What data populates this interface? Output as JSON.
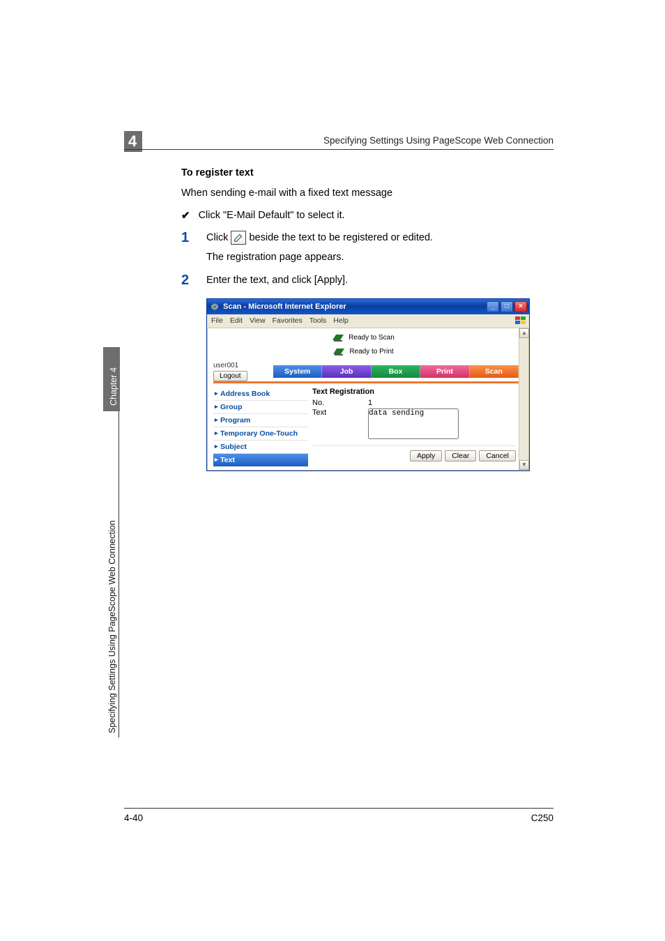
{
  "chapter_tab_number": "4",
  "header_right": "Specifying Settings Using PageScope Web Connection",
  "section": {
    "title": "To register text",
    "intro": "When sending e-mail with a fixed text message",
    "checklist_item": "Click \"E-Mail Default\" to select it.",
    "steps": [
      {
        "num": "1",
        "text_before": "Click ",
        "text_after": " beside the text to be registered or edited.",
        "sub": "The registration page appears."
      },
      {
        "num": "2",
        "text": "Enter the text, and click [Apply]."
      }
    ]
  },
  "screenshot": {
    "title": "Scan - Microsoft Internet Explorer",
    "menu": [
      "File",
      "Edit",
      "View",
      "Favorites",
      "Tools",
      "Help"
    ],
    "status": {
      "line1": "Ready to Scan",
      "line2": "Ready to Print"
    },
    "user": "user001",
    "logout": "Logout",
    "tabs": {
      "system": "System",
      "job": "Job",
      "box": "Box",
      "print": "Print",
      "scan": "Scan"
    },
    "sidebar": [
      "Address Book",
      "Group",
      "Program",
      "Temporary One-Touch",
      "Subject",
      "Text"
    ],
    "sidebar_active_index": 5,
    "panel": {
      "title": "Text Registration",
      "no_label": "No.",
      "no_value": "1",
      "text_label": "Text",
      "text_value": "data sending"
    },
    "buttons": {
      "apply": "Apply",
      "clear": "Clear",
      "cancel": "Cancel"
    },
    "win_controls": {
      "min": "_",
      "max": "□",
      "close": "×"
    }
  },
  "side_caption": {
    "chip": "Chapter 4",
    "long": "Specifying Settings Using PageScope Web Connection"
  },
  "footer": {
    "left": "4-40",
    "right": "C250"
  }
}
